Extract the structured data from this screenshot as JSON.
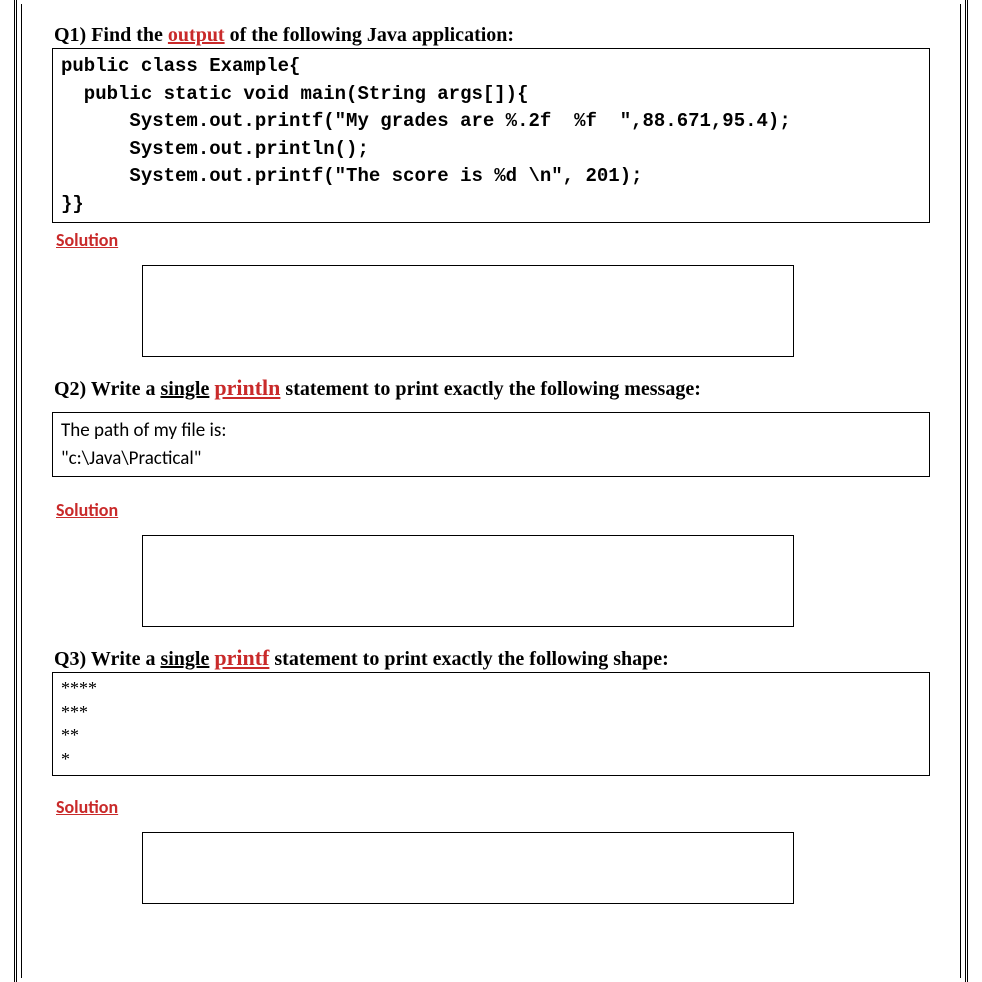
{
  "q1": {
    "heading_pre": "Q1) Find the ",
    "heading_red": "output",
    "heading_post": " of the following Java application:",
    "code": "public class Example{\n  public static void main(String args[]){\n      System.out.printf(\"My grades are %.2f  %f  \",88.671,95.4);\n      System.out.println();\n      System.out.printf(\"The score is %d \\n\", 201);\n}}",
    "solution_label": "Solution"
  },
  "q2": {
    "heading_pre": "Q2) Write a ",
    "heading_single": "single",
    "heading_red": "println",
    "heading_post": " statement to print exactly the following message:",
    "msg": "The path of my file is:\n\"c:\\Java\\Practical\"",
    "solution_label": "Solution"
  },
  "q3": {
    "heading_pre": "Q3) Write a ",
    "heading_single": "single",
    "heading_red": "printf",
    "heading_post": " statement to print exactly the following shape:",
    "shape": "****\n***\n**\n*",
    "solution_label": "Solution"
  }
}
